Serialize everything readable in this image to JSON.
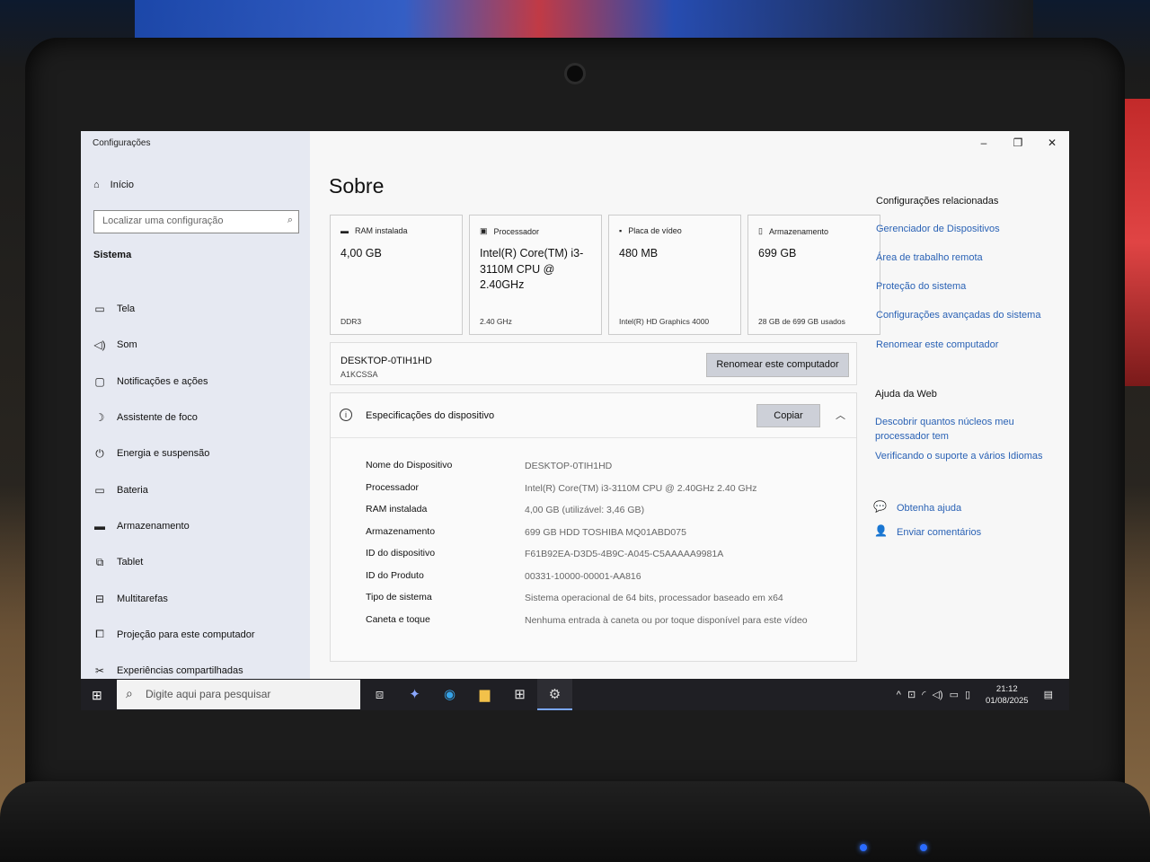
{
  "window": {
    "title": "Configurações",
    "controls": [
      "–",
      "❐",
      "✕"
    ]
  },
  "sidebar": {
    "home_label": "Início",
    "search_placeholder": "Localizar uma configuração",
    "section": "Sistema",
    "items": [
      {
        "label": "Tela",
        "icon": "display-icon"
      },
      {
        "label": "Som",
        "icon": "speaker-icon"
      },
      {
        "label": "Notificações e ações",
        "icon": "notification-icon"
      },
      {
        "label": "Assistente de foco",
        "icon": "moon-icon"
      },
      {
        "label": "Energia e suspensão",
        "icon": "power-icon"
      },
      {
        "label": "Bateria",
        "icon": "battery-icon"
      },
      {
        "label": "Armazenamento",
        "icon": "storage-icon"
      },
      {
        "label": "Tablet",
        "icon": "tablet-icon"
      },
      {
        "label": "Multitarefas",
        "icon": "multitask-icon"
      },
      {
        "label": "Projeção para este computador",
        "icon": "projection-icon"
      },
      {
        "label": "Experiências compartilhadas",
        "icon": "shared-icon"
      }
    ]
  },
  "main": {
    "title": "Sobre",
    "cards": [
      {
        "header": "RAM instalada",
        "value": "4,00 GB",
        "sub": "DDR3"
      },
      {
        "header": "Processador",
        "value": "Intel(R) Core(TM) i3-3110M CPU @ 2.40GHz",
        "sub": "2.40 GHz"
      },
      {
        "header": "Placa de vídeo",
        "value": "480 MB",
        "sub": "Intel(R) HD Graphics 4000"
      },
      {
        "header": "Armazenamento",
        "value": "699 GB",
        "sub": "28 GB de 699 GB usados"
      }
    ],
    "device_name": "DESKTOP-0TIH1HD",
    "workgroup": "A1KCSSA",
    "rename_button": "Renomear este computador",
    "specs_header": "Especificações do dispositivo",
    "copy_button": "Copiar",
    "specs": [
      {
        "key": "Nome do Dispositivo",
        "value": "DESKTOP-0TIH1HD"
      },
      {
        "key": "Processador",
        "value": "Intel(R) Core(TM) i3-3110M CPU @ 2.40GHz   2.40 GHz"
      },
      {
        "key": "RAM instalada",
        "value": "4,00 GB (utilizável: 3,46 GB)"
      },
      {
        "key": "Armazenamento",
        "value": "699 GB HDD TOSHIBA MQ01ABD075"
      },
      {
        "key": "ID do dispositivo",
        "value": "F61B92EA-D3D5-4B9C-A045-C5AAAAA9981A"
      },
      {
        "key": "ID do Produto",
        "value": "00331-10000-00001-AA816"
      },
      {
        "key": "Tipo de sistema",
        "value": "Sistema operacional de 64 bits, processador baseado em x64"
      },
      {
        "key": "Caneta e toque",
        "value": "Nenhuma entrada à caneta ou por toque disponível para este vídeo"
      }
    ]
  },
  "related": {
    "heading": "Configurações relacionadas",
    "links": [
      "Gerenciador de Dispositivos",
      "Área de trabalho remota",
      "Proteção do sistema",
      "Configurações avançadas do sistema",
      "Renomear este computador"
    ],
    "web_heading": "Ajuda da Web",
    "web_links": [
      "Descobrir quantos núcleos meu processador tem",
      "Verificando o suporte a vários Idiomas"
    ],
    "help": "Obtenha ajuda",
    "feedback": "Enviar comentários"
  },
  "taskbar": {
    "search_placeholder": "Digite aqui para pesquisar",
    "time": "21:12",
    "date": "01/08/2025"
  }
}
